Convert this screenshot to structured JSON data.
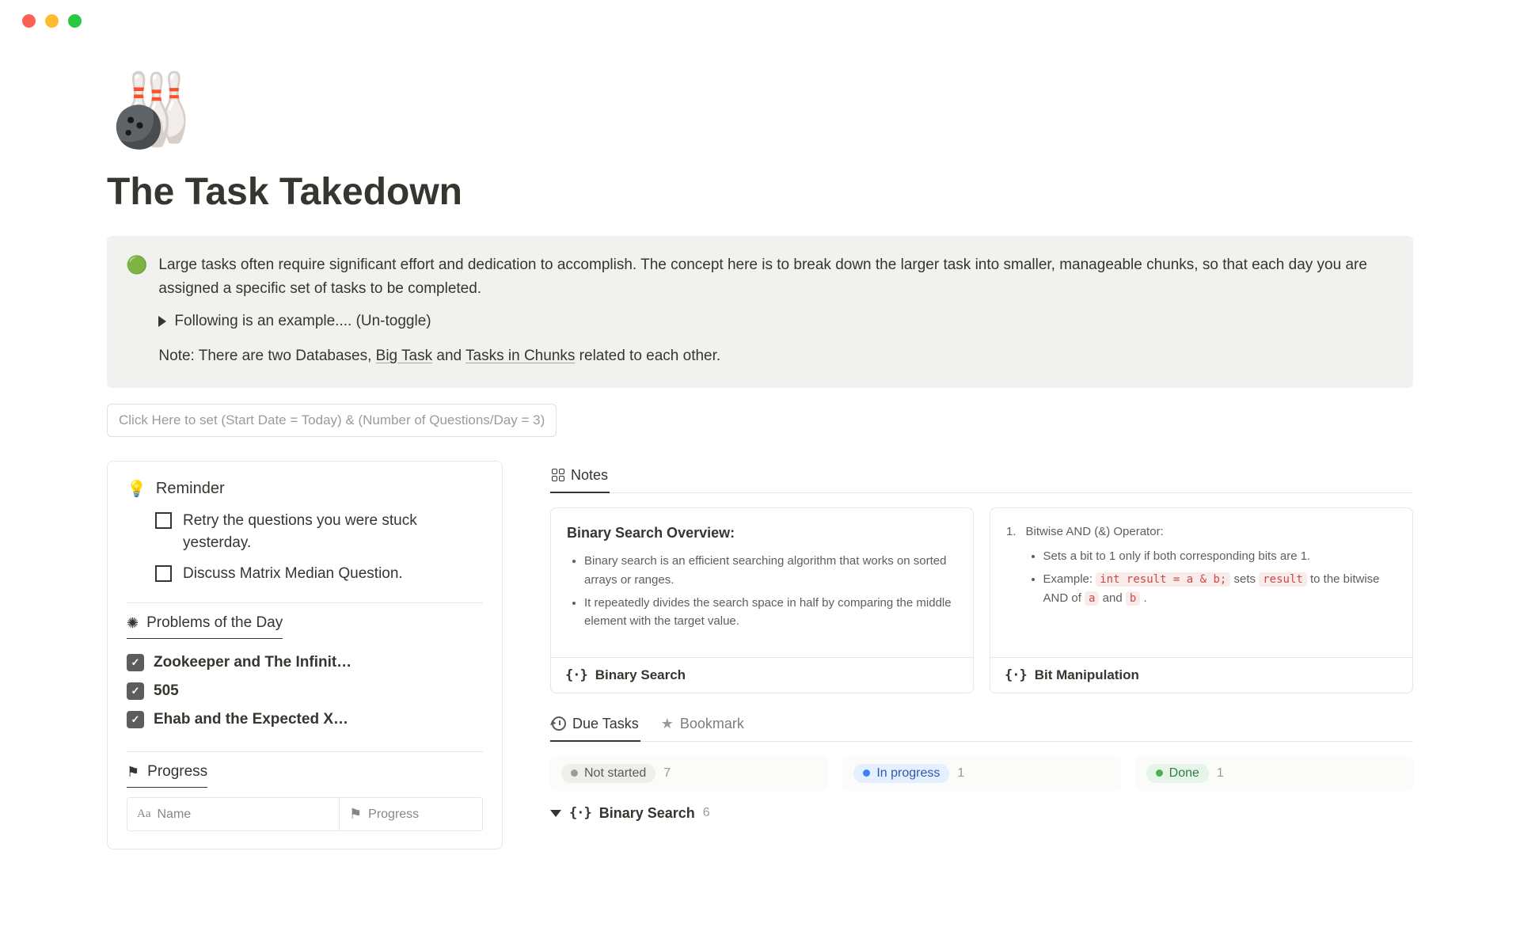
{
  "traffic": {
    "colors": [
      "#ff5f57",
      "#febc2e",
      "#28c840"
    ]
  },
  "page": {
    "icon": "🎳",
    "title": "The Task Takedown"
  },
  "callout": {
    "emoji": "🟢",
    "text": "Large tasks often require significant effort and dedication to accomplish. The concept here is to break down the larger task into smaller, manageable chunks, so that each day you are assigned a specific set of tasks to be completed.",
    "toggle_label": "Following is an example.... (Un-toggle)",
    "note_prefix": "Note: There are two Databases, ",
    "note_link1": "Big Task",
    "note_mid": " and ",
    "note_link2": "Tasks in Chunks",
    "note_suffix": " related to each other."
  },
  "button": {
    "label": "Click Here to set (Start Date = Today) & (Number of Questions/Day = 3)"
  },
  "reminder": {
    "icon": "💡",
    "title": "Reminder",
    "todos": [
      "Retry the questions you were stuck yesterday.",
      "Discuss Matrix Median Question."
    ]
  },
  "problems": {
    "icon": "☀",
    "title": "Problems of the Day",
    "items": [
      "Zookeeper and The Infinit…",
      "505",
      "Ehab and the Expected X…"
    ]
  },
  "progress": {
    "icon": "⚑",
    "title": "Progress",
    "col1_icon": "Aa",
    "col1": "Name",
    "col2_icon": "⚑",
    "col2": "Progress"
  },
  "notes_tab": {
    "label": "Notes"
  },
  "card1": {
    "title": "Binary Search Overview:",
    "b1": "Binary search is an efficient searching algorithm that works on sorted arrays or ranges.",
    "b2": "It repeatedly divides the search space in half by comparing the middle element with the target value.",
    "footer": "Binary Search"
  },
  "card2": {
    "ol_label": "1.",
    "heading": "Bitwise AND (&) Operator:",
    "b1": "Sets a bit to 1 only if both corresponding bits are 1.",
    "b2_prefix": "Example: ",
    "code1": "int result = a & b;",
    "b2_mid": " sets ",
    "code2": "result",
    "b2_mid2": " to the bitwise AND of ",
    "code3": "a",
    "b2_mid3": " and ",
    "code4": "b",
    "b2_end": " .",
    "footer": "Bit Manipulation"
  },
  "tasks_tabs": {
    "due": "Due Tasks",
    "bookmark": "Bookmark"
  },
  "board": {
    "not_started": {
      "label": "Not started",
      "count": "7"
    },
    "in_progress": {
      "label": "In progress",
      "count": "1"
    },
    "done": {
      "label": "Done",
      "count": "1"
    }
  },
  "group": {
    "name": "Binary Search",
    "count": "6"
  }
}
